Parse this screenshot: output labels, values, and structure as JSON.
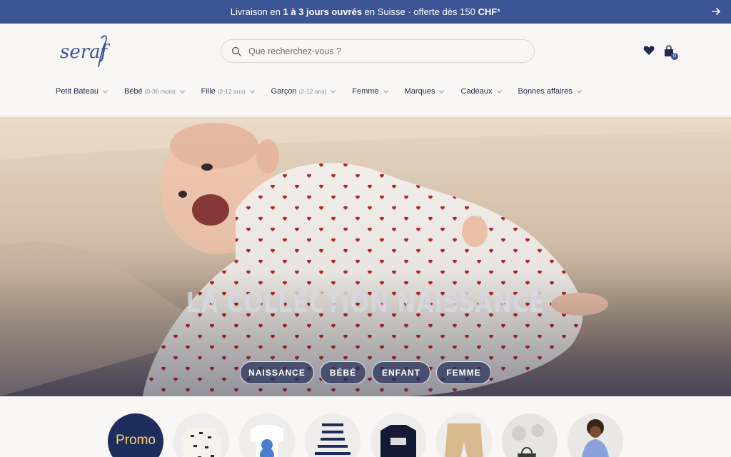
{
  "announcement": {
    "prefix": "Livraison en ",
    "bold1": "1 à 3 jours ouvrés",
    "middle": " en Suisse · offerte dès 150 ",
    "bold2": "CHF",
    "suffix": "*"
  },
  "header": {
    "logo_text": "seraf",
    "search_placeholder": "Que recherchez-vous ?",
    "bag_count": "0"
  },
  "nav": [
    {
      "label": "Petit Bateau",
      "sub": ""
    },
    {
      "label": "Bébé",
      "sub": "(0-36 mois)"
    },
    {
      "label": "Fille",
      "sub": "(2-12 ans)"
    },
    {
      "label": "Garçon",
      "sub": "(2-12 ans)"
    },
    {
      "label": "Femme",
      "sub": ""
    },
    {
      "label": "Marques",
      "sub": ""
    },
    {
      "label": "Cadeaux",
      "sub": ""
    },
    {
      "label": "Bonnes affaires",
      "sub": ""
    }
  ],
  "hero": {
    "title": "LA COLLECTION NAISSANCE",
    "buttons": [
      "NAISSANCE",
      "BÉBÉ",
      "ENFANT",
      "FEMME"
    ]
  },
  "categories": {
    "promo_label": "Promo",
    "items": [
      "promo",
      "printed-pyjama",
      "bear-tshirt",
      "striped-dress",
      "grand-sweatshirt",
      "beige-shorts",
      "tote-bag",
      "girl-jacket"
    ]
  },
  "colors": {
    "brand_blue": "#3b5594",
    "navy": "#1f2d5c",
    "promo_yellow": "#f4d36a",
    "heart_red": "#b8262b"
  }
}
